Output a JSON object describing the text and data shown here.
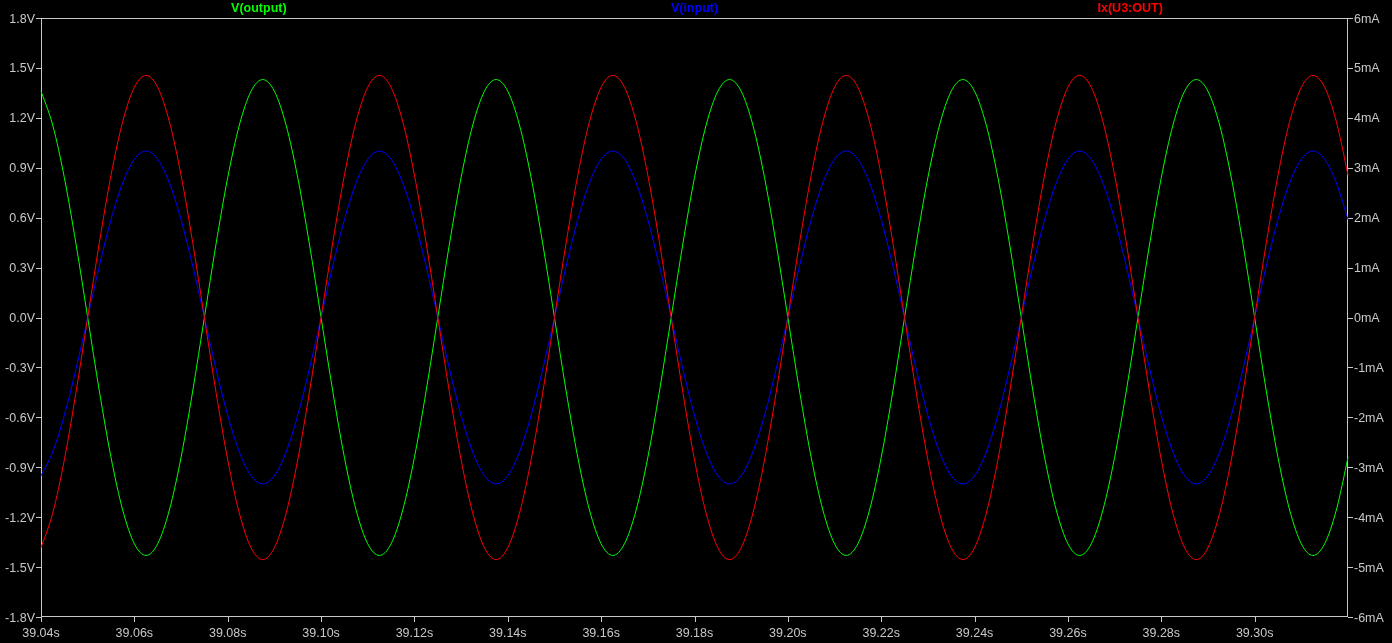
{
  "plot": {
    "chart_data": {
      "type": "line",
      "x": [
        39.04,
        39.0425,
        39.045,
        39.0475,
        39.05,
        39.0525,
        39.055,
        39.0575,
        39.06,
        39.0625,
        39.065,
        39.0675,
        39.07,
        39.0725,
        39.075,
        39.0775,
        39.08,
        39.0825,
        39.085,
        39.0875,
        39.09,
        39.0925,
        39.095,
        39.0975,
        39.1,
        39.1025,
        39.105,
        39.1075,
        39.11,
        39.1125,
        39.115,
        39.1175,
        39.12,
        39.1225,
        39.125,
        39.1275,
        39.13,
        39.1325,
        39.135,
        39.1375,
        39.14,
        39.1425,
        39.145,
        39.1475,
        39.15,
        39.1525,
        39.155,
        39.1575,
        39.16,
        39.1625,
        39.165,
        39.1675,
        39.17,
        39.1725,
        39.175,
        39.1775,
        39.18,
        39.1825,
        39.185,
        39.1875,
        39.19,
        39.1925,
        39.195,
        39.1975,
        39.2,
        39.2025,
        39.205,
        39.2075,
        39.21,
        39.2125,
        39.215,
        39.2175,
        39.22,
        39.2225,
        39.225,
        39.2275,
        39.23,
        39.2325,
        39.235,
        39.2375,
        39.24,
        39.2425,
        39.245,
        39.2475,
        39.25,
        39.2525,
        39.255,
        39.2575,
        39.26,
        39.2625,
        39.265,
        39.2675,
        39.27,
        39.2725,
        39.275,
        39.2775,
        39.28,
        39.2825,
        39.285,
        39.2875,
        39.29,
        39.2925,
        39.295,
        39.2975,
        39.3,
        39.3025,
        39.305,
        39.3075,
        39.31,
        39.3125,
        39.315,
        39.3175,
        39.32
      ],
      "xlim": [
        39.04,
        39.32
      ],
      "xticks": [
        {
          "value": 39.04,
          "label": "39.04s"
        },
        {
          "value": 39.06,
          "label": "39.06s"
        },
        {
          "value": 39.08,
          "label": "39.08s"
        },
        {
          "value": 39.1,
          "label": "39.10s"
        },
        {
          "value": 39.12,
          "label": "39.12s"
        },
        {
          "value": 39.14,
          "label": "39.14s"
        },
        {
          "value": 39.16,
          "label": "39.16s"
        },
        {
          "value": 39.18,
          "label": "39.18s"
        },
        {
          "value": 39.2,
          "label": "39.20s"
        },
        {
          "value": 39.22,
          "label": "39.22s"
        },
        {
          "value": 39.24,
          "label": "39.24s"
        },
        {
          "value": 39.26,
          "label": "39.26s"
        },
        {
          "value": 39.28,
          "label": "39.28s"
        },
        {
          "value": 39.3,
          "label": "39.30s"
        }
      ],
      "ylim": [
        -1.8,
        1.8
      ],
      "yticks": [
        {
          "value": 1.8,
          "label": "1.8V"
        },
        {
          "value": 1.5,
          "label": "1.5V"
        },
        {
          "value": 1.2,
          "label": "1.2V"
        },
        {
          "value": 0.9,
          "label": "0.9V"
        },
        {
          "value": 0.6,
          "label": "0.6V"
        },
        {
          "value": 0.3,
          "label": "0.3V"
        },
        {
          "value": 0,
          "label": "0.0V"
        },
        {
          "value": -0.3,
          "label": "-0.3V"
        },
        {
          "value": -0.6,
          "label": "-0.6V"
        },
        {
          "value": -0.9,
          "label": "-0.9V"
        },
        {
          "value": -1.2,
          "label": "-1.2V"
        },
        {
          "value": -1.5,
          "label": "-1.5V"
        },
        {
          "value": -1.8,
          "label": "-1.8V"
        }
      ],
      "y2lim": [
        -6,
        6
      ],
      "y2ticks": [
        {
          "value": 6,
          "label": "6mA"
        },
        {
          "value": 5,
          "label": "5mA"
        },
        {
          "value": 4,
          "label": "4mA"
        },
        {
          "value": 3,
          "label": "3mA"
        },
        {
          "value": 2,
          "label": "2mA"
        },
        {
          "value": 1,
          "label": "1mA"
        },
        {
          "value": 0,
          "label": "0mA"
        },
        {
          "value": -1,
          "label": "-1mA"
        },
        {
          "value": -2,
          "label": "-2mA"
        },
        {
          "value": -3,
          "label": "-3mA"
        },
        {
          "value": -4,
          "label": "-4mA"
        },
        {
          "value": -5,
          "label": "-5mA"
        },
        {
          "value": -6,
          "label": "-6mA"
        }
      ],
      "series": [
        {
          "name": "V(output)",
          "color": "#00ff00",
          "values": [
            1.36,
            1.157,
            0.841,
            0.442,
            0,
            -0.442,
            -0.841,
            -1.157,
            -1.36,
            -1.43,
            -1.36,
            -1.157,
            -0.841,
            -0.442,
            0,
            0.442,
            0.841,
            1.157,
            1.36,
            1.43,
            1.36,
            1.157,
            0.841,
            0.442,
            0,
            -0.442,
            -0.841,
            -1.157,
            -1.36,
            -1.43,
            -1.36,
            -1.157,
            -0.841,
            -0.442,
            0,
            0.442,
            0.841,
            1.157,
            1.36,
            1.43,
            1.36,
            1.157,
            0.841,
            0.442,
            0,
            -0.442,
            -0.841,
            -1.157,
            -1.36,
            -1.43,
            -1.36,
            -1.157,
            -0.841,
            -0.442,
            0,
            0.442,
            0.841,
            1.157,
            1.36,
            1.43,
            1.36,
            1.157,
            0.841,
            0.442,
            0,
            -0.442,
            -0.841,
            -1.157,
            -1.36,
            -1.43,
            -1.36,
            -1.157,
            -0.841,
            -0.442,
            0,
            0.442,
            0.841,
            1.157,
            1.36,
            1.43,
            1.36,
            1.157,
            0.841,
            0.442,
            0,
            -0.442,
            -0.841,
            -1.157,
            -1.36,
            -1.43,
            -1.36,
            -1.157,
            -0.841,
            -0.442,
            0,
            0.442,
            0.841,
            1.157,
            1.36,
            1.43,
            1.36,
            1.157,
            0.841,
            0.442,
            0,
            -0.442,
            -0.841,
            -1.157,
            -1.36,
            -1.43,
            -1.36,
            -1.157,
            -0.841
          ]
        },
        {
          "name": "V(input)",
          "color": "#0000ff",
          "values": [
            -0.951,
            -0.809,
            -0.588,
            -0.309,
            0,
            0.309,
            0.588,
            0.809,
            0.951,
            1,
            0.951,
            0.809,
            0.588,
            0.309,
            0,
            -0.309,
            -0.588,
            -0.809,
            -0.951,
            -1,
            -0.951,
            -0.809,
            -0.588,
            -0.309,
            0,
            0.309,
            0.588,
            0.809,
            0.951,
            1,
            0.951,
            0.809,
            0.588,
            0.309,
            0,
            -0.309,
            -0.588,
            -0.809,
            -0.951,
            -1,
            -0.951,
            -0.809,
            -0.588,
            -0.309,
            0,
            0.309,
            0.588,
            0.809,
            0.951,
            1,
            0.951,
            0.809,
            0.588,
            0.309,
            0,
            -0.309,
            -0.588,
            -0.809,
            -0.951,
            -1,
            -0.951,
            -0.809,
            -0.588,
            -0.309,
            0,
            0.309,
            0.588,
            0.809,
            0.951,
            1,
            0.951,
            0.809,
            0.588,
            0.309,
            0,
            -0.309,
            -0.588,
            -0.809,
            -0.951,
            -1,
            -0.951,
            -0.809,
            -0.588,
            -0.309,
            0,
            0.309,
            0.588,
            0.809,
            0.951,
            1,
            0.951,
            0.809,
            0.588,
            0.309,
            0,
            -0.309,
            -0.588,
            -0.809,
            -0.951,
            -1,
            -0.951,
            -0.809,
            -0.588,
            -0.309,
            0,
            0.309,
            0.588,
            0.809,
            0.951,
            1,
            0.951,
            0.809,
            0.588
          ]
        },
        {
          "name": "Ix(U3:OUT)",
          "color": "#ff0000",
          "axis": "y2",
          "values": [
            -4.612,
            -3.924,
            -2.852,
            -1.499,
            0,
            1.499,
            2.852,
            3.924,
            4.612,
            4.85,
            4.612,
            3.924,
            2.852,
            1.499,
            0,
            -1.499,
            -2.852,
            -3.924,
            -4.612,
            -4.85,
            -4.612,
            -3.924,
            -2.852,
            -1.499,
            0,
            1.499,
            2.852,
            3.924,
            4.612,
            4.85,
            4.612,
            3.924,
            2.852,
            1.499,
            0,
            -1.499,
            -2.852,
            -3.924,
            -4.612,
            -4.85,
            -4.612,
            -3.924,
            -2.852,
            -1.499,
            0,
            1.499,
            2.852,
            3.924,
            4.612,
            4.85,
            4.612,
            3.924,
            2.852,
            1.499,
            0,
            -1.499,
            -2.852,
            -3.924,
            -4.612,
            -4.85,
            -4.612,
            -3.924,
            -2.852,
            -1.499,
            0,
            1.499,
            2.852,
            3.924,
            4.612,
            4.85,
            4.612,
            3.924,
            2.852,
            1.499,
            0,
            -1.499,
            -2.852,
            -3.924,
            -4.612,
            -4.85,
            -4.612,
            -3.924,
            -2.852,
            -1.499,
            0,
            1.499,
            2.852,
            3.924,
            4.612,
            4.85,
            4.612,
            3.924,
            2.852,
            1.499,
            0,
            -1.499,
            -2.852,
            -3.924,
            -4.612,
            -4.85,
            -4.612,
            -3.924,
            -2.852,
            -1.499,
            0,
            1.499,
            2.852,
            3.924,
            4.612,
            4.85,
            4.612,
            3.924,
            2.852
          ]
        }
      ]
    }
  }
}
